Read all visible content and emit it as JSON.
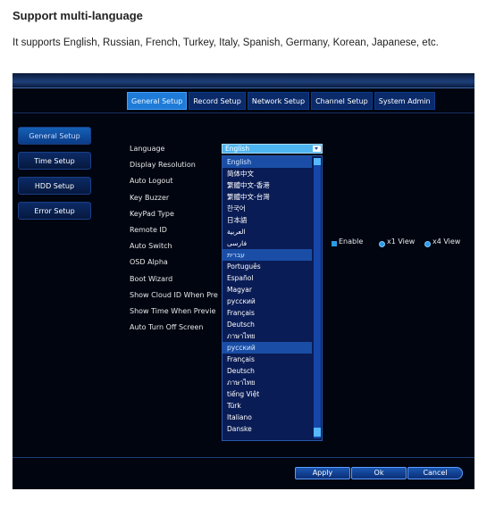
{
  "header": {
    "title": "Support multi-language",
    "description": "It supports English, Russian, French, Turkey, Italy, Spanish, Germany, Korean, Japanese, etc."
  },
  "tabs": [
    {
      "label": "General Setup",
      "active": true
    },
    {
      "label": "Record Setup",
      "active": false
    },
    {
      "label": "Network Setup",
      "active": false
    },
    {
      "label": "Channel Setup",
      "active": false
    },
    {
      "label": "System Admin",
      "active": false
    }
  ],
  "sidebar": [
    {
      "label": "General Setup",
      "active": true
    },
    {
      "label": "Time Setup",
      "active": false
    },
    {
      "label": "HDD Setup",
      "active": false
    },
    {
      "label": "Error Setup",
      "active": false
    }
  ],
  "settings": [
    "Language",
    "Display Resolution",
    "Auto Logout",
    "Key Buzzer",
    "KeyPad Type",
    "Remote ID",
    "Auto Switch",
    "OSD Alpha",
    "Boot Wizard",
    "Show Cloud ID When Pre",
    "Show Time When Previe",
    "Auto Turn Off Screen"
  ],
  "language_select": {
    "value": "English"
  },
  "language_options": [
    {
      "label": "English",
      "highlighted": true
    },
    {
      "label": "简体中文",
      "highlighted": false
    },
    {
      "label": "繁體中文-香港",
      "highlighted": false
    },
    {
      "label": "繁體中文-台灣",
      "highlighted": false
    },
    {
      "label": "한국어",
      "highlighted": false
    },
    {
      "label": "日本語",
      "highlighted": false
    },
    {
      "label": "العربية",
      "highlighted": false
    },
    {
      "label": "فارسی",
      "highlighted": false
    },
    {
      "label": "עברית",
      "highlighted": true
    },
    {
      "label": "Português",
      "highlighted": false
    },
    {
      "label": "Español",
      "highlighted": false
    },
    {
      "label": "Magyar",
      "highlighted": false
    },
    {
      "label": "русский",
      "highlighted": false
    },
    {
      "label": "Français",
      "highlighted": false
    },
    {
      "label": "Deutsch",
      "highlighted": false
    },
    {
      "label": "ภาษาไทย",
      "highlighted": false
    },
    {
      "label": "русский",
      "highlighted": true
    },
    {
      "label": "Français",
      "highlighted": false
    },
    {
      "label": "Deutsch",
      "highlighted": false
    },
    {
      "label": "ภาษาไทย",
      "highlighted": false
    },
    {
      "label": "tiếng Việt",
      "highlighted": false
    },
    {
      "label": "Türk",
      "highlighted": false
    },
    {
      "label": "Italiano",
      "highlighted": false
    },
    {
      "label": "Danske",
      "highlighted": false
    }
  ],
  "auto_switch": {
    "enable_label": "Enable",
    "x1_label": "x1 View",
    "x4_label": "x4 View"
  },
  "buttons": {
    "apply": "Apply",
    "ok": "Ok",
    "cancel": "Cancel"
  },
  "colors": {
    "accent": "#1e7bd8",
    "screen_background": "#000510"
  }
}
